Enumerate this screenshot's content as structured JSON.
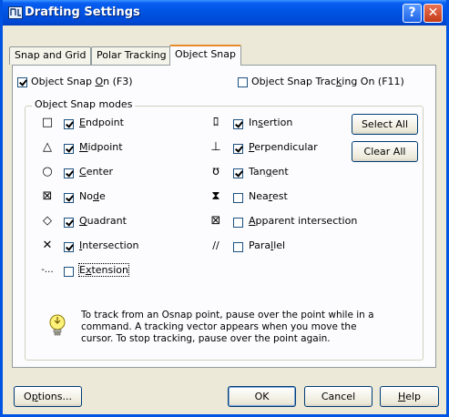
{
  "window": {
    "title": "Drafting Settings",
    "help_glyph": "?",
    "close_glyph": "✕"
  },
  "tabs": [
    {
      "label": "Snap and Grid"
    },
    {
      "label": "Polar Tracking"
    },
    {
      "label": "Object Snap",
      "active": true
    }
  ],
  "options": {
    "osnap_on": {
      "pre": "Object Snap ",
      "acc": "O",
      "post": "n (F3)",
      "checked": true
    },
    "tracking_on": {
      "pre": "Object Snap Trac",
      "acc": "k",
      "post": "ing On (F11)",
      "checked": false
    }
  },
  "group_title": "Object Snap modes",
  "left_modes": [
    {
      "icon": "□",
      "pre": "",
      "acc": "E",
      "post": "ndpoint",
      "checked": true
    },
    {
      "icon": "△",
      "pre": "",
      "acc": "M",
      "post": "idpoint",
      "checked": true
    },
    {
      "icon": "○",
      "pre": "",
      "acc": "C",
      "post": "enter",
      "checked": true
    },
    {
      "icon": "⊠",
      "pre": "No",
      "acc": "d",
      "post": "e",
      "checked": true
    },
    {
      "icon": "◇",
      "pre": "",
      "acc": "Q",
      "post": "uadrant",
      "checked": true
    },
    {
      "icon": "✕",
      "pre": "",
      "acc": "I",
      "post": "ntersection",
      "checked": true
    },
    {
      "icon": "-…",
      "pre": "E",
      "acc": "x",
      "post": "tension",
      "checked": false
    }
  ],
  "right_modes": [
    {
      "icon": "ﾛ",
      "pre": "In",
      "acc": "s",
      "post": "ertion",
      "checked": true
    },
    {
      "icon": "⊥",
      "pre": "",
      "acc": "P",
      "post": "erpendicular",
      "checked": true
    },
    {
      "icon": "ʊ",
      "pre": "Tan",
      "acc": "g",
      "post": "ent",
      "checked": true
    },
    {
      "icon": "⧗",
      "pre": "Nea",
      "acc": "r",
      "post": "est",
      "checked": false
    },
    {
      "icon": "⊠",
      "pre": "",
      "acc": "A",
      "post": "pparent intersection",
      "checked": false
    },
    {
      "icon": "∕∕",
      "pre": "Para",
      "acc": "l",
      "post": "lel",
      "checked": false
    }
  ],
  "side_buttons": {
    "select_all": "Select All",
    "clear_all": "Clear All"
  },
  "info": {
    "icon": "lightbulb-icon",
    "text": "To track from an Osnap point, pause over the point while in a command.  A tracking vector appears when you move the cursor. To stop tracking, pause over the point again."
  },
  "footer": {
    "options": {
      "pre": "O",
      "acc": "p",
      "post": "tions..."
    },
    "ok": "OK",
    "cancel": "Cancel",
    "help": {
      "pre": "",
      "acc": "H",
      "post": "elp"
    }
  }
}
